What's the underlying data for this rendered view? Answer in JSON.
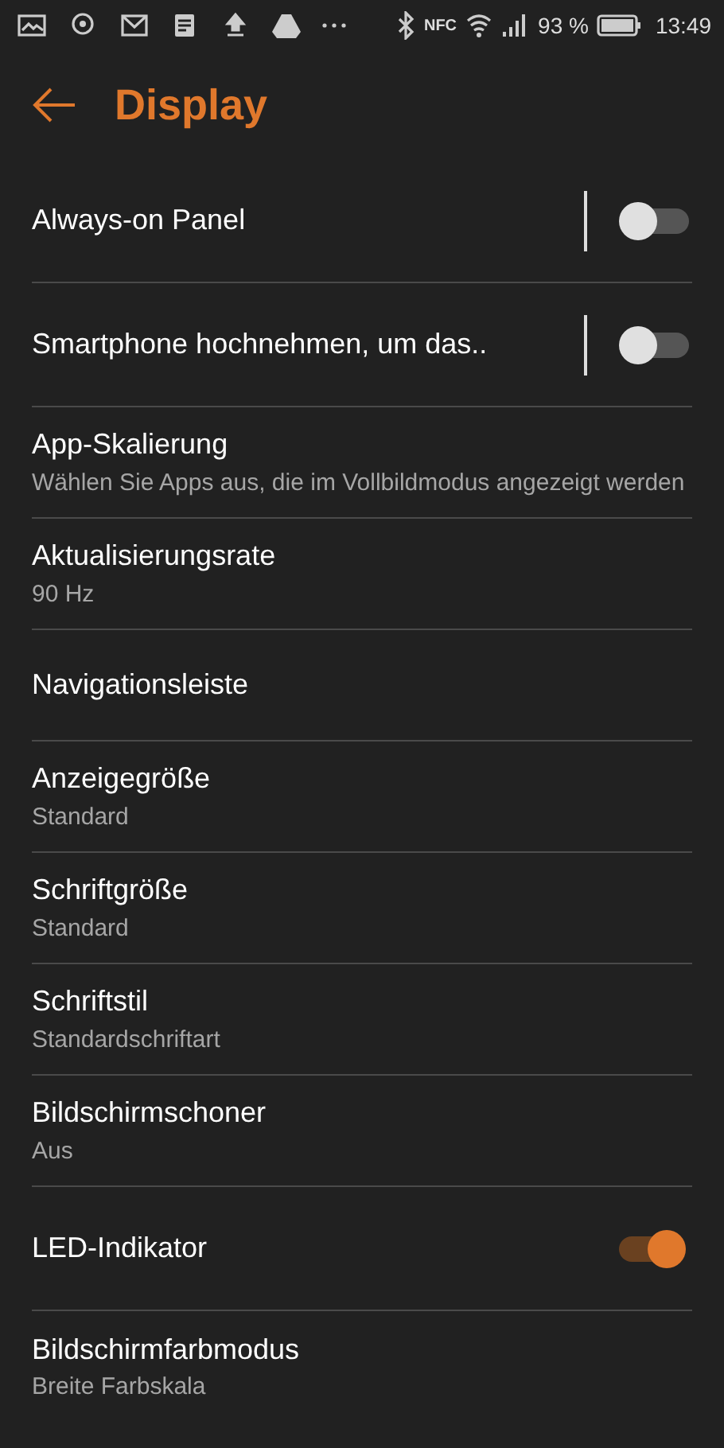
{
  "status_bar": {
    "nfc": "NFC",
    "battery": "93 %",
    "time": "13:49"
  },
  "header": {
    "title": "Display"
  },
  "settings": [
    {
      "kind": "toggle",
      "title": "Always-on Panel",
      "on": false,
      "divider": true
    },
    {
      "kind": "toggle",
      "title": "Smartphone hochnehmen, um das..",
      "on": false,
      "divider": true
    },
    {
      "kind": "plain",
      "title": "App-Skalierung",
      "subtitle": "Wählen Sie Apps aus, die im Vollbildmodus angezeigt werden"
    },
    {
      "kind": "plain",
      "title": "Aktualisierungsrate",
      "subtitle": "90 Hz"
    },
    {
      "kind": "plain",
      "title": "Navigationsleiste"
    },
    {
      "kind": "plain",
      "title": "Anzeigegröße",
      "subtitle": "Standard"
    },
    {
      "kind": "plain",
      "title": "Schriftgröße",
      "subtitle": "Standard"
    },
    {
      "kind": "plain",
      "title": "Schriftstil",
      "subtitle": "Standardschriftart"
    },
    {
      "kind": "plain",
      "title": "Bildschirmschoner",
      "subtitle": "Aus"
    },
    {
      "kind": "toggle",
      "title": "LED-Indikator",
      "on": true,
      "divider": false
    },
    {
      "kind": "plain",
      "title": "Bildschirmfarbmodus",
      "subtitle": "Breite Farbskala"
    }
  ]
}
